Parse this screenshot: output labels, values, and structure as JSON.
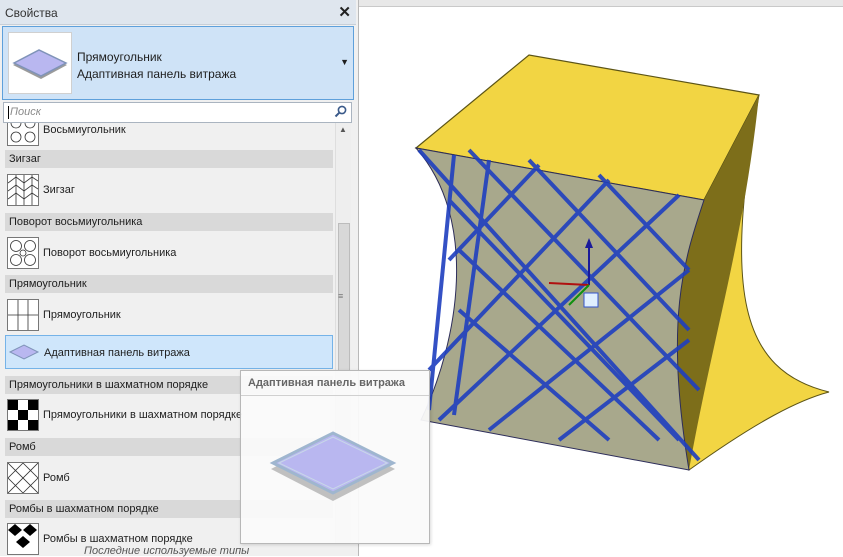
{
  "panel": {
    "title": "Свойства",
    "close_symbol": "✕",
    "selector": {
      "name": "Прямоугольник",
      "type": "Адаптивная панель витража",
      "dropdown_icon": "chevron-down-icon"
    },
    "search": {
      "placeholder": "Поиск",
      "icon": "search-icon"
    },
    "list": [
      {
        "kind": "item",
        "label": "Восьмиугольник",
        "icon": "octagon-pattern-icon"
      },
      {
        "kind": "header",
        "label": "Зигзаг"
      },
      {
        "kind": "item",
        "label": "Зигзаг",
        "icon": "zigzag-pattern-icon"
      },
      {
        "kind": "header",
        "label": "Поворот восьмиугольника"
      },
      {
        "kind": "item",
        "label": "Поворот восьмиугольника",
        "icon": "rotated-octagon-pattern-icon"
      },
      {
        "kind": "header",
        "label": "Прямоугольник"
      },
      {
        "kind": "item",
        "label": "Прямоугольник",
        "icon": "rectangle-grid-icon"
      },
      {
        "kind": "item",
        "label": "Адаптивная панель витража",
        "icon": "curtain-panel-icon",
        "selected": true
      },
      {
        "kind": "header",
        "label": "Прямоугольники в шахматном порядке"
      },
      {
        "kind": "item",
        "label": "Прямоугольники в шахматном порядке",
        "icon": "checkerboard-icon"
      },
      {
        "kind": "header",
        "label": "Ромб"
      },
      {
        "kind": "item",
        "label": "Ромб",
        "icon": "rhombus-pattern-icon"
      },
      {
        "kind": "header",
        "label": "Ромбы в шахматном порядке"
      },
      {
        "kind": "item",
        "label": "Ромбы в шахматном порядке",
        "icon": "rhombus-checker-icon"
      }
    ],
    "footer": "Последние используемые типы"
  },
  "tooltip": {
    "title": "Адаптивная панель витража"
  },
  "colors": {
    "selection_bg": "#cfe6fb",
    "selection_border": "#75b3e8",
    "model_face": "#f2d543",
    "model_dark": "#8c7c18",
    "surface": "#a8a88c",
    "grid": "#1f3fbf",
    "panel_fill": "#b9b7f0"
  }
}
